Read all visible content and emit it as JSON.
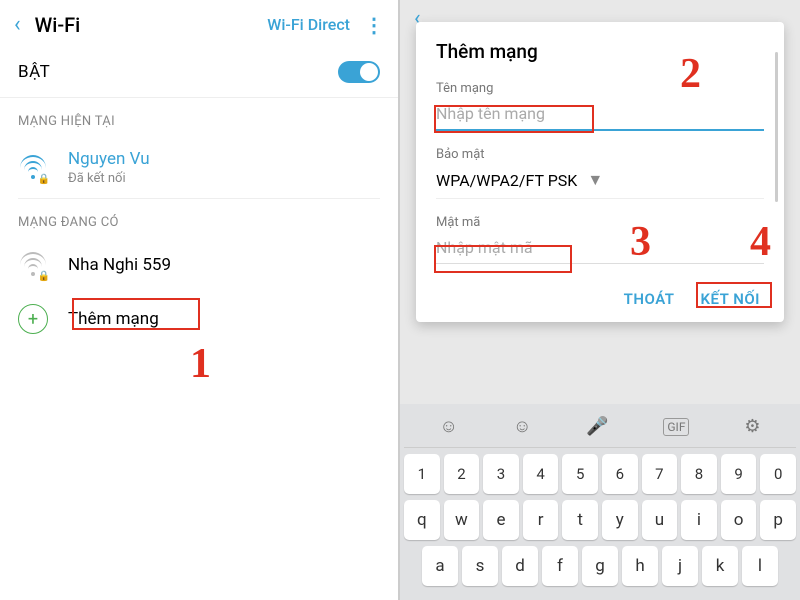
{
  "left": {
    "title": "Wi-Fi",
    "wifi_direct": "Wi-Fi Direct",
    "toggle_label": "BẬT",
    "section_current": "MẠNG HIỆN TẠI",
    "section_available": "MẠNG ĐANG CÓ",
    "current": {
      "name": "Nguyen Vu",
      "status": "Đã kết nối"
    },
    "available": [
      {
        "name": "Nha Nghi 559"
      }
    ],
    "add_network": "Thêm mạng"
  },
  "right": {
    "dialog_title": "Thêm mạng",
    "name_label": "Tên mạng",
    "name_placeholder": "Nhập tên mạng",
    "security_label": "Bảo mật",
    "security_value": "WPA/WPA2/FT PSK",
    "password_label": "Mật mã",
    "password_placeholder": "Nhập mật mã",
    "cancel": "THOÁT",
    "connect": "KẾT NỐI"
  },
  "keyboard": {
    "rows": [
      [
        "1",
        "2",
        "3",
        "4",
        "5",
        "6",
        "7",
        "8",
        "9",
        "0"
      ],
      [
        "q",
        "w",
        "e",
        "r",
        "t",
        "y",
        "u",
        "i",
        "o",
        "p"
      ],
      [
        "a",
        "s",
        "d",
        "f",
        "g",
        "h",
        "j",
        "k",
        "l"
      ]
    ]
  },
  "annotations": {
    "n1": "1",
    "n2": "2",
    "n3": "3",
    "n4": "4"
  }
}
